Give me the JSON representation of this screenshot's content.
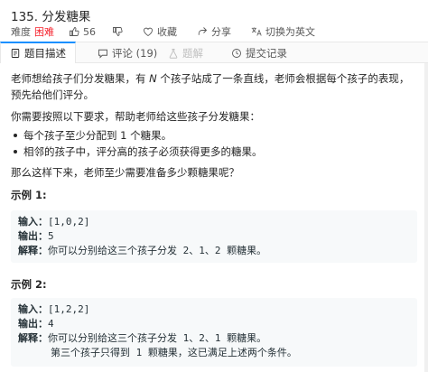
{
  "problem": {
    "title": "135. 分发糖果",
    "difficulty_label": "难度",
    "difficulty": "困难",
    "likes": "56",
    "favorite": "收藏",
    "share": "分享",
    "switch_lang": "切换为英文"
  },
  "tabs": [
    {
      "label": "题目描述"
    },
    {
      "label": "评论 (19)"
    },
    {
      "label": "题解"
    },
    {
      "label": "提交记录"
    }
  ],
  "description": {
    "p1_a": "老师想给孩子们分发糖果，有 ",
    "p1_n": "N",
    "p1_b": " 个孩子站成了一条直线，老师会根据每个孩子的表现，预先给他们评分。",
    "p2": "你需要按照以下要求，帮助老师给这些孩子分发糖果：",
    "rules": [
      "每个孩子至少分配到 1 个糖果。",
      "相邻的孩子中，评分高的孩子必须获得更多的糖果。"
    ],
    "p3": "那么这样下来，老师至少需要准备多少颗糖果呢？"
  },
  "examples": [
    {
      "title": "示例 1:",
      "input_label": "输入：",
      "input": "[1,0,2]",
      "output_label": "输出：",
      "output": "5",
      "explain_label": "解释：",
      "explain": "你可以分别给这三个孩子分发 2、1、2 颗糖果。",
      "explain2": ""
    },
    {
      "title": "示例 2:",
      "input_label": "输入：",
      "input": "[1,2,2]",
      "output_label": "输出：",
      "output": "4",
      "explain_label": "解释：",
      "explain": "你可以分别给这三个孩子分发 1、2、1 颗糖果。",
      "explain2": "第三个孩子只得到 1 颗糖果，这已满足上述两个条件。"
    }
  ],
  "colors": {
    "accent": "#1890ff",
    "difficulty_hard": "#f5222d",
    "example_bg": "#f7f9fa",
    "tabs_bg": "#fafafa"
  }
}
